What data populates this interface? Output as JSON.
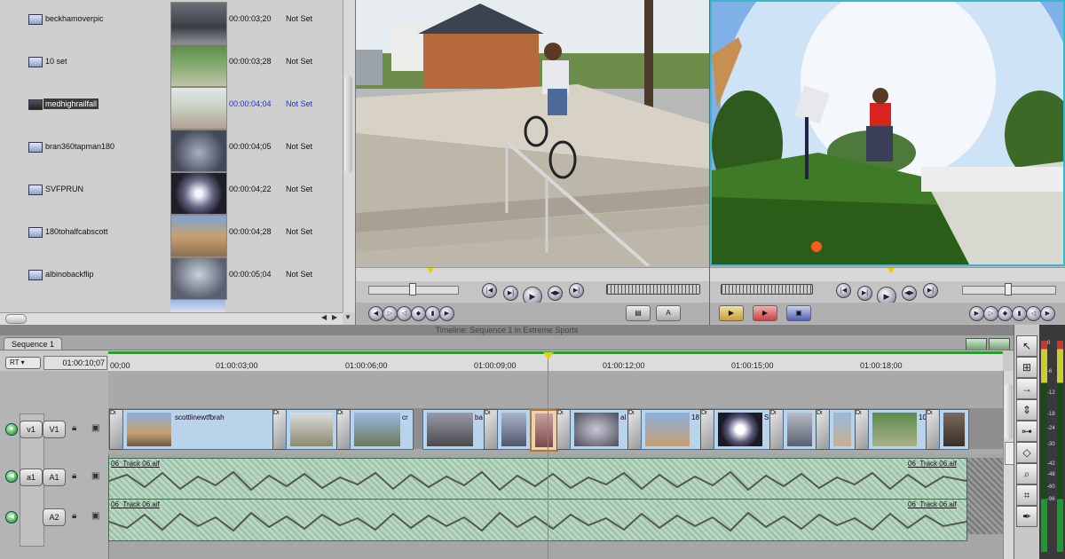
{
  "browser": {
    "items": [
      {
        "name": "beckhamoverpic",
        "duration": "00:00:03;20",
        "in_out": "Not Set"
      },
      {
        "name": "10 set",
        "duration": "00:00:03;28",
        "in_out": "Not Set"
      },
      {
        "name": "medhighrailfall",
        "duration": "00:00:04;04",
        "in_out": "Not Set",
        "selected": true
      },
      {
        "name": "bran360tapman180",
        "duration": "00:00:04;05",
        "in_out": "Not Set"
      },
      {
        "name": "SVFPRUN",
        "duration": "00:00:04;22",
        "in_out": "Not Set"
      },
      {
        "name": "180tohalfcabscott",
        "duration": "00:00:04;28",
        "in_out": "Not Set"
      },
      {
        "name": "albinobackflip",
        "duration": "00:00:05;04",
        "in_out": "Not Set"
      }
    ]
  },
  "timeline": {
    "window_title": "Timeline: Sequence 1 in Extreme Sports",
    "tab": "Sequence 1",
    "rt_label": "RT",
    "timecode": "01:00:10;07",
    "ruler": [
      "00;00",
      "01:00:03;00",
      "01:00:06;00",
      "01:00:09;00",
      "01:00:12;00",
      "01:00:15;00",
      "01:00:18;00"
    ],
    "tracks": {
      "v_src": "v1",
      "v_dst": "V1",
      "a_src": "a1",
      "a1": "A1",
      "a2": "A2"
    },
    "clip_labels": [
      "Di",
      "scottlinewtfbrah",
      "Di",
      "Di",
      "cr",
      "ba",
      "Di",
      "Di",
      "Di",
      "al",
      "Di",
      "18",
      "Di",
      "S",
      "Di",
      "Di",
      "10",
      "Di"
    ],
    "audio_label": "06_Track 06.aif"
  },
  "meter_labels": [
    "0",
    "-6",
    "-12",
    "-18",
    "-24",
    "-30",
    "-42",
    "-48",
    "-60",
    "-96"
  ],
  "colors": {
    "selection": "#1a35d6",
    "clip": "#b9d3ea",
    "audio": "#b9d8c4",
    "render": "#2c9a2c",
    "playhead": "#e8d000"
  }
}
